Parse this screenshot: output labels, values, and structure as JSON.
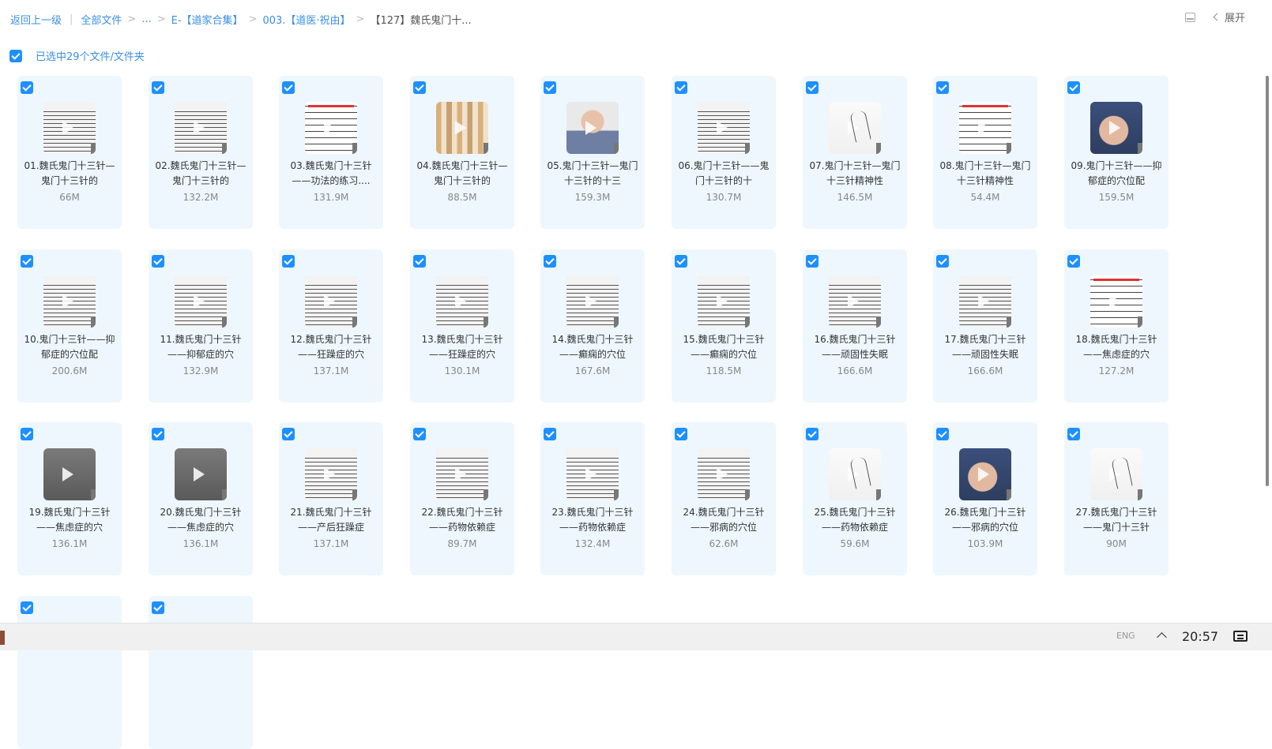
{
  "breadcrumb": {
    "back": "返回上一级",
    "items": [
      "全部文件",
      "...",
      "E-【道家合集】",
      "003.【道医·祝由】",
      "【127】魏氏鬼门十..."
    ]
  },
  "toolbar": {
    "expand_label": "展开",
    "layout_icon": "list-layout-icon",
    "chevron_icon": "chevron-left-icon"
  },
  "selection": {
    "label": "已选中29个文件/文件夹",
    "checked": true
  },
  "files": [
    {
      "name": "01.魏氏鬼门十三针—鬼门十三针的",
      "size": "66M",
      "thumb": "text"
    },
    {
      "name": "02.魏氏鬼门十三针—鬼门十三针的",
      "size": "132.2M",
      "thumb": "text"
    },
    {
      "name": "03.魏氏鬼门十三针——功法的练习....",
      "size": "131.9M",
      "thumb": "redlist"
    },
    {
      "name": "04.魏氏鬼门十三针—鬼门十三针的",
      "size": "88.5M",
      "thumb": "board"
    },
    {
      "name": "05.鬼门十三针—鬼门十三针的十三",
      "size": "159.3M",
      "thumb": "person"
    },
    {
      "name": "06.鬼门十三针——鬼门十三针的十",
      "size": "130.7M",
      "thumb": "text"
    },
    {
      "name": "07.鬼门十三针—鬼门十三针精神性",
      "size": "146.5M",
      "thumb": "sketch"
    },
    {
      "name": "08.鬼门十三针—鬼门十三针精神性",
      "size": "54.4M",
      "thumb": "redlist"
    },
    {
      "name": "09.鬼门十三针——抑郁症的穴位配",
      "size": "159.5M",
      "thumb": "face"
    },
    {
      "name": "10.鬼门十三针——抑郁症的穴位配",
      "size": "200.6M",
      "thumb": "text"
    },
    {
      "name": "11.魏氏鬼门十三针——抑郁症的穴",
      "size": "132.9M",
      "thumb": "text"
    },
    {
      "name": "12.魏氏鬼门十三针——狂躁症的穴",
      "size": "137.1M",
      "thumb": "text"
    },
    {
      "name": "13.魏氏鬼门十三针——狂躁症的穴",
      "size": "130.1M",
      "thumb": "text"
    },
    {
      "name": "14.魏氏鬼门十三针——癫痫的穴位",
      "size": "167.6M",
      "thumb": "text"
    },
    {
      "name": "15.魏氏鬼门十三针——癫痫的穴位",
      "size": "118.5M",
      "thumb": "text"
    },
    {
      "name": "16.魏氏鬼门十三针——顽固性失眠",
      "size": "166.6M",
      "thumb": "text"
    },
    {
      "name": "17.魏氏鬼门十三针——顽固性失眠",
      "size": "166.6M",
      "thumb": "text"
    },
    {
      "name": "18.魏氏鬼门十三针——焦虑症的穴",
      "size": "127.2M",
      "thumb": "redlist"
    },
    {
      "name": "19.魏氏鬼门十三针——焦虑症的穴",
      "size": "136.1M",
      "thumb": "dark"
    },
    {
      "name": "20.魏氏鬼门十三针——焦虑症的穴",
      "size": "136.1M",
      "thumb": "dark"
    },
    {
      "name": "21.魏氏鬼门十三针——产后狂躁症",
      "size": "137.1M",
      "thumb": "text"
    },
    {
      "name": "22.魏氏鬼门十三针——药物依赖症",
      "size": "89.7M",
      "thumb": "text"
    },
    {
      "name": "23.魏氏鬼门十三针——药物依赖症",
      "size": "132.4M",
      "thumb": "text"
    },
    {
      "name": "24.魏氏鬼门十三针——邪病的穴位",
      "size": "62.6M",
      "thumb": "text"
    },
    {
      "name": "25.魏氏鬼门十三针——药物依赖症",
      "size": "59.6M",
      "thumb": "sketch"
    },
    {
      "name": "26.魏氏鬼门十三针——邪病的穴位",
      "size": "103.9M",
      "thumb": "face"
    },
    {
      "name": "27.魏氏鬼门十三针——鬼门十三针",
      "size": "90M",
      "thumb": "sketch"
    },
    {
      "name": "",
      "size": "",
      "thumb": "none"
    },
    {
      "name": "",
      "size": "",
      "thumb": "none"
    }
  ],
  "taskbar": {
    "time": "20:57",
    "ime": "ENG",
    "up_icon": "chevron-up-icon",
    "notify_icon": "notification-icon"
  }
}
